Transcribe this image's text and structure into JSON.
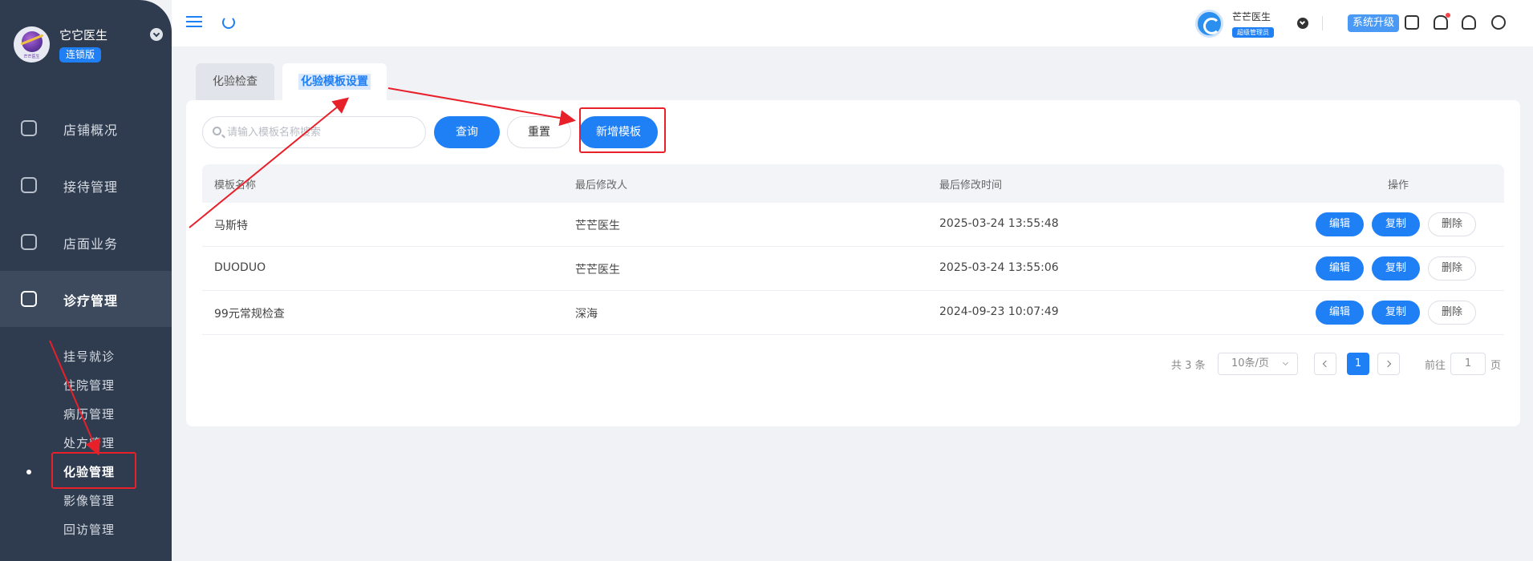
{
  "sidebar": {
    "brand_name": "它它医生",
    "brand_badge": "连锁版",
    "logo_caption": "芒芒医生",
    "menu": [
      {
        "label": "店铺概况",
        "icon": "store-icon"
      },
      {
        "label": "接待管理",
        "icon": "reception-icon"
      },
      {
        "label": "店面业务",
        "icon": "shop-icon"
      },
      {
        "label": "诊疗管理",
        "icon": "medical-kit-icon"
      }
    ],
    "submenu": [
      "挂号就诊",
      "住院管理",
      "病历管理",
      "处方管理",
      "化验管理",
      "影像管理",
      "回访管理"
    ]
  },
  "header": {
    "user_name": "芒芒医生",
    "user_role": "超级管理员",
    "upgrade_label": "系统升级",
    "icons": [
      "calendar-icon",
      "bell-icon",
      "headset-icon",
      "clock-icon"
    ]
  },
  "tabs": [
    "化验检查",
    "化验模板设置"
  ],
  "toolbar": {
    "search_placeholder": "请输入模板名称搜索",
    "search_label": "查询",
    "reset_label": "重置",
    "add_label": "新增模板"
  },
  "table": {
    "columns": [
      "模板名称",
      "最后修改人",
      "最后修改时间",
      "操作"
    ],
    "rows": [
      {
        "name": "马斯特",
        "modifier": "芒芒医生",
        "time": "2025-03-24 13:55:48"
      },
      {
        "name": "DUODUO",
        "modifier": "芒芒医生",
        "time": "2025-03-24 13:55:06"
      },
      {
        "name": "99元常规检查",
        "modifier": "深海",
        "time": "2024-09-23 10:07:49"
      }
    ],
    "actions": {
      "edit": "编辑",
      "copy": "复制",
      "delete": "删除"
    }
  },
  "pagination": {
    "total": "共 3 条",
    "page_size": "10条/页",
    "current_page": "1",
    "goto_label": "前往",
    "goto_value": "1",
    "page_suffix": "页"
  },
  "colors": {
    "primary": "#1f7ff5",
    "sidebar": "#2f3b4e",
    "annotation": "#e8202a"
  }
}
